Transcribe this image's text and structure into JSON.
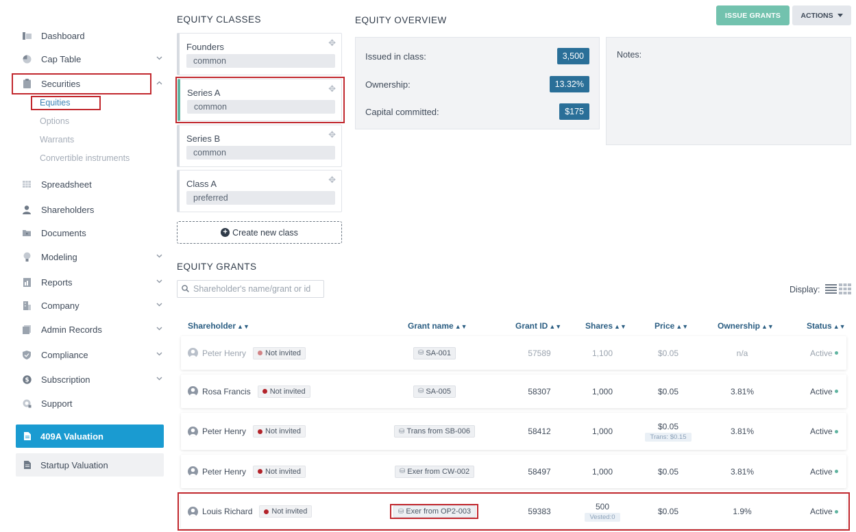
{
  "sidebar": {
    "items": [
      {
        "label": "Dashboard",
        "icon": "dashboard-icon"
      },
      {
        "label": "Cap Table",
        "icon": "pie-chart-icon"
      },
      {
        "label": "Securities",
        "icon": "clipboard-icon"
      },
      {
        "label": "Spreadsheet",
        "icon": "spreadsheet-icon"
      },
      {
        "label": "Shareholders",
        "icon": "user-icon"
      },
      {
        "label": "Documents",
        "icon": "folder-icon"
      },
      {
        "label": "Modeling",
        "icon": "lightbulb-icon"
      },
      {
        "label": "Reports",
        "icon": "report-icon"
      },
      {
        "label": "Company",
        "icon": "building-icon"
      },
      {
        "label": "Admin Records",
        "icon": "records-icon"
      },
      {
        "label": "Compliance",
        "icon": "shield-icon"
      },
      {
        "label": "Subscription",
        "icon": "dollar-circle-icon"
      },
      {
        "label": "Support",
        "icon": "support-icon"
      }
    ],
    "securities_sub": [
      "Equities",
      "Options",
      "Warrants",
      "Convertible instruments"
    ],
    "valuation_409a": "409A Valuation",
    "startup_valuation": "Startup Valuation"
  },
  "equity_classes": {
    "title": "EQUITY CLASSES",
    "classes": [
      {
        "name": "Founders",
        "type": "common"
      },
      {
        "name": "Series A",
        "type": "common"
      },
      {
        "name": "Series B",
        "type": "common"
      },
      {
        "name": "Class A",
        "type": "preferred"
      }
    ],
    "create_label": "Create new class"
  },
  "overview": {
    "title": "EQUITY OVERVIEW",
    "issued_label": "Issued in class:",
    "issued_value": "3,500",
    "ownership_label": "Ownership:",
    "ownership_value": "13.32%",
    "capital_label": "Capital committed:",
    "capital_value": "$175",
    "notes_label": "Notes:"
  },
  "toolbar": {
    "issue_grants": "ISSUE GRANTS",
    "actions": "ACTIONS"
  },
  "grants": {
    "title": "EQUITY GRANTS",
    "search_placeholder": "Shareholder's name/grant or id",
    "display_label": "Display:",
    "columns": [
      "Shareholder",
      "Grant name",
      "Grant ID",
      "Shares",
      "Price",
      "Ownership",
      "Status"
    ],
    "rows": [
      {
        "shareholder": "Peter Henry",
        "invite": "Not invited",
        "grant": "SA-001",
        "grant_id": "57589",
        "shares": "1,100",
        "price": "$0.05",
        "ownership": "n/a",
        "status": "Active"
      },
      {
        "shareholder": "Rosa Francis",
        "invite": "Not invited",
        "grant": "SA-005",
        "grant_id": "58307",
        "shares": "1,000",
        "price": "$0.05",
        "ownership": "3.81%",
        "status": "Active"
      },
      {
        "shareholder": "Peter Henry",
        "invite": "Not invited",
        "grant": "Trans from SB-006",
        "grant_id": "58412",
        "shares": "1,000",
        "price": "$0.05",
        "price_sub": "Trans: $0.15",
        "ownership": "3.81%",
        "status": "Active"
      },
      {
        "shareholder": "Peter Henry",
        "invite": "Not invited",
        "grant": "Exer from CW-002",
        "grant_id": "58497",
        "shares": "1,000",
        "price": "$0.05",
        "ownership": "3.81%",
        "status": "Active"
      },
      {
        "shareholder": "Louis Richard",
        "invite": "Not invited",
        "grant": "Exer from OP2-003",
        "grant_id": "59383",
        "shares": "500",
        "shares_sub": "Vested:0",
        "price": "$0.05",
        "ownership": "1.9%",
        "status": "Active"
      }
    ]
  }
}
